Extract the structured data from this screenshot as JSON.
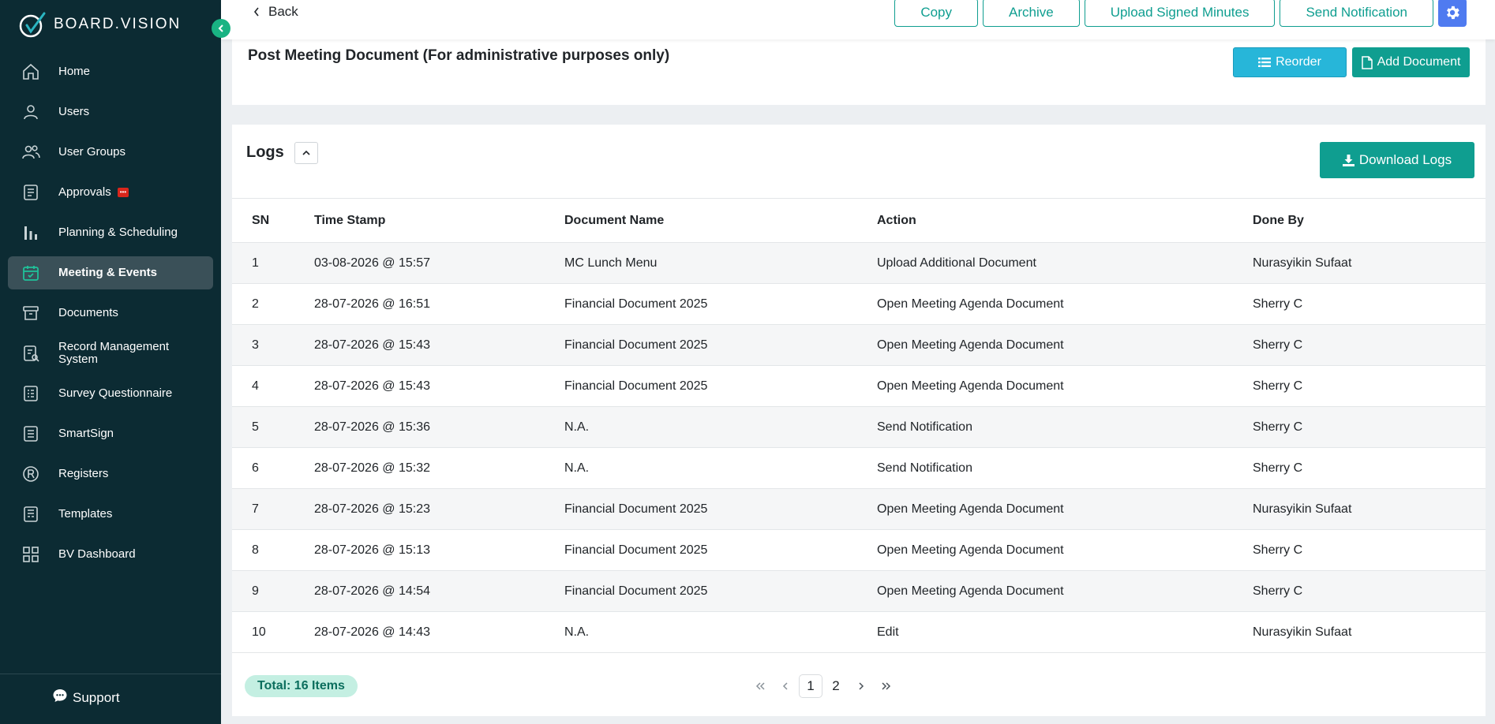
{
  "brand": {
    "name": "BOARD.VISION"
  },
  "sidebar": {
    "items": [
      {
        "label": "Home",
        "icon": "home-icon"
      },
      {
        "label": "Users",
        "icon": "user-icon"
      },
      {
        "label": "User Groups",
        "icon": "users-icon"
      },
      {
        "label": "Approvals",
        "icon": "document-icon",
        "badge": "•••"
      },
      {
        "label": "Planning & Scheduling",
        "icon": "bar-chart-icon"
      },
      {
        "label": "Meeting & Events",
        "icon": "calendar-check-icon",
        "active": true
      },
      {
        "label": "Documents",
        "icon": "archive-box-icon"
      },
      {
        "label": "Record Management System",
        "icon": "record-search-icon"
      },
      {
        "label": "Survey Questionnaire",
        "icon": "survey-icon"
      },
      {
        "label": "SmartSign",
        "icon": "smartsign-icon"
      },
      {
        "label": "Registers",
        "icon": "registered-icon"
      },
      {
        "label": "Templates",
        "icon": "template-icon"
      },
      {
        "label": "BV Dashboard",
        "icon": "grid-icon"
      }
    ],
    "support_label": "Support"
  },
  "topbar": {
    "back_label": "Back",
    "actions": [
      "Copy",
      "Archive",
      "Upload Signed Minutes",
      "Send Notification"
    ]
  },
  "post_meeting": {
    "title": "Post Meeting Document (For administrative purposes only)",
    "reorder_label": "Reorder",
    "add_document_label": "Add Document"
  },
  "logs": {
    "title": "Logs",
    "download_label": "Download Logs",
    "columns": [
      "SN",
      "Time Stamp",
      "Document Name",
      "Action",
      "Done By"
    ],
    "rows": [
      [
        "1",
        "03-08-2026 @ 15:57",
        "MC Lunch Menu",
        "Upload Additional Document",
        "Nurasyikin Sufaat"
      ],
      [
        "2",
        "28-07-2026 @ 16:51",
        "Financial Document 2025",
        "Open Meeting Agenda Document",
        "Sherry C"
      ],
      [
        "3",
        "28-07-2026 @ 15:43",
        "Financial Document 2025",
        "Open Meeting Agenda Document",
        "Sherry C"
      ],
      [
        "4",
        "28-07-2026 @ 15:43",
        "Financial Document 2025",
        "Open Meeting Agenda Document",
        "Sherry C"
      ],
      [
        "5",
        "28-07-2026 @ 15:36",
        "N.A.",
        "Send Notification",
        "Sherry C"
      ],
      [
        "6",
        "28-07-2026 @ 15:32",
        "N.A.",
        "Send Notification",
        "Sherry C"
      ],
      [
        "7",
        "28-07-2026 @ 15:23",
        "Financial Document 2025",
        "Open Meeting Agenda Document",
        "Nurasyikin Sufaat"
      ],
      [
        "8",
        "28-07-2026 @ 15:13",
        "Financial Document 2025",
        "Open Meeting Agenda Document",
        "Sherry C"
      ],
      [
        "9",
        "28-07-2026 @ 14:54",
        "Financial Document 2025",
        "Open Meeting Agenda Document",
        "Sherry C"
      ],
      [
        "10",
        "28-07-2026 @ 14:43",
        "N.A.",
        "Edit",
        "Nurasyikin Sufaat"
      ]
    ],
    "total_label": "Total: 16 Items",
    "pagination": {
      "pages": [
        "1",
        "2"
      ],
      "current": "1"
    }
  },
  "colors": {
    "sidebar_bg": "#0c2b33",
    "accent_teal": "#0f9e90",
    "reorder_blue": "#27b6d9",
    "gear_blue": "#4f7bf0",
    "toggle_green": "#19b383"
  }
}
